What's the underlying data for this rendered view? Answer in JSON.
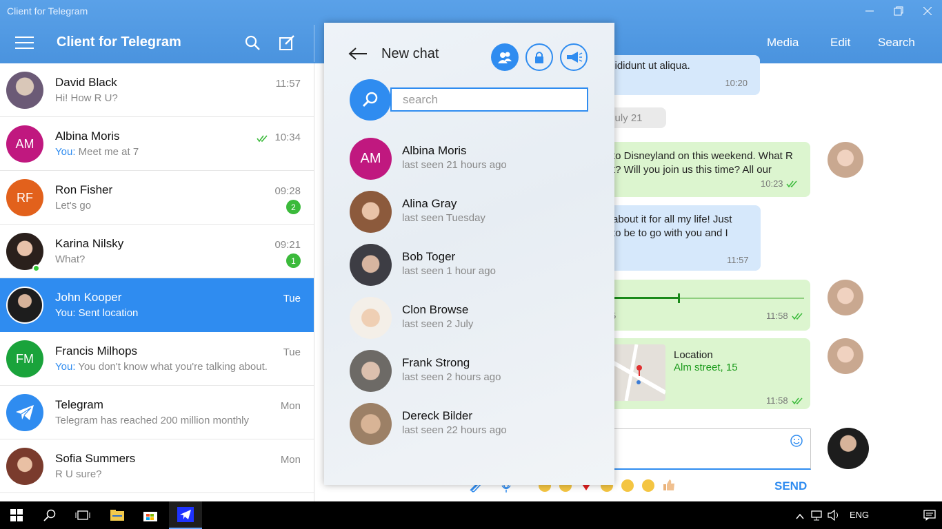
{
  "window": {
    "title": "Client for Telegram",
    "controls": [
      "minimize-icon",
      "maximize-icon",
      "close-icon"
    ]
  },
  "header": {
    "app_title": "Client for Telegram",
    "nav": [
      "Media",
      "Edit",
      "Search"
    ]
  },
  "chats": [
    {
      "name": "David Black",
      "preview_you": "",
      "preview": "Hi! How R U?",
      "time": "11:57",
      "badge": "",
      "initials": "",
      "color": "#6b5a76"
    },
    {
      "name": "Albina Moris",
      "preview_you": "You:",
      "preview": " Meet me at 7",
      "time": "10:34",
      "badge": "",
      "initials": "AM",
      "color": "#c0187f"
    },
    {
      "name": "Ron Fisher",
      "preview_you": "",
      "preview": "Let's go",
      "time": "09:28",
      "badge": "2",
      "initials": "RF",
      "color": "#e2611c"
    },
    {
      "name": "Karina Nilsky",
      "preview_you": "",
      "preview": "What?",
      "time": "09:21",
      "badge": "1",
      "initials": "",
      "color": "#5b4a45"
    },
    {
      "name": "John Kooper",
      "preview_you": "You:",
      "preview": " Sent location",
      "time": "Tue",
      "badge": "",
      "initials": "",
      "color": "#3a3a3a"
    },
    {
      "name": "Francis Milhops",
      "preview_you": "You:",
      "preview": " You don't know what you're talking about.",
      "time": "Tue",
      "badge": "",
      "initials": "FM",
      "color": "#1aa33b"
    },
    {
      "name": "Telegram",
      "preview_you": "",
      "preview": "Telegram has reached 200 million monthly",
      "time": "Mon",
      "badge": "",
      "initials": "",
      "color": "#2f8cf0"
    },
    {
      "name": "Sofia Summers",
      "preview_you": "",
      "preview": "R U sure?",
      "time": "Mon",
      "badge": "",
      "initials": "",
      "color": "#a05a4a"
    }
  ],
  "conversation": {
    "msg1": {
      "text": "cididunt ut aliqua.",
      "time": "10:20"
    },
    "date": "July 21",
    "msg2": {
      "text": "to Disneyland on this weekend. What R\nt? Will you join us this time? All our",
      "time": "10:23"
    },
    "msg3": {
      "text": "about it for all my life! Just\nto be to go with you and I",
      "time": "11:57"
    },
    "msg4": {
      "audio_elapsed": "5",
      "time": "11:58",
      "progress": 0.34
    },
    "msg5": {
      "location_title": "Location",
      "location_address": "Alm street, 15",
      "time": "11:58"
    },
    "send_label": "SEND"
  },
  "new_chat": {
    "title": "New chat",
    "search_placeholder": "search",
    "contacts": [
      {
        "name": "Albina Moris",
        "last_seen": "last seen 21 hours ago",
        "initials": "AM",
        "color": "#c0187f"
      },
      {
        "name": "Alina Gray",
        "last_seen": "last seen Tuesday",
        "initials": "",
        "color": "#a06a55"
      },
      {
        "name": "Bob Toger",
        "last_seen": "last seen 1 hour ago",
        "initials": "",
        "color": "#3d3d44"
      },
      {
        "name": "Clon Browse",
        "last_seen": "last seen 2 July",
        "initials": "",
        "color": "#c9a27c"
      },
      {
        "name": "Frank Strong",
        "last_seen": "last seen 2 hours ago",
        "initials": "",
        "color": "#6d6a66"
      },
      {
        "name": "Dereck Bilder",
        "last_seen": "last seen 22 hours ago",
        "initials": "",
        "color": "#9c8066"
      }
    ]
  },
  "taskbar": {
    "language": "ENG"
  }
}
